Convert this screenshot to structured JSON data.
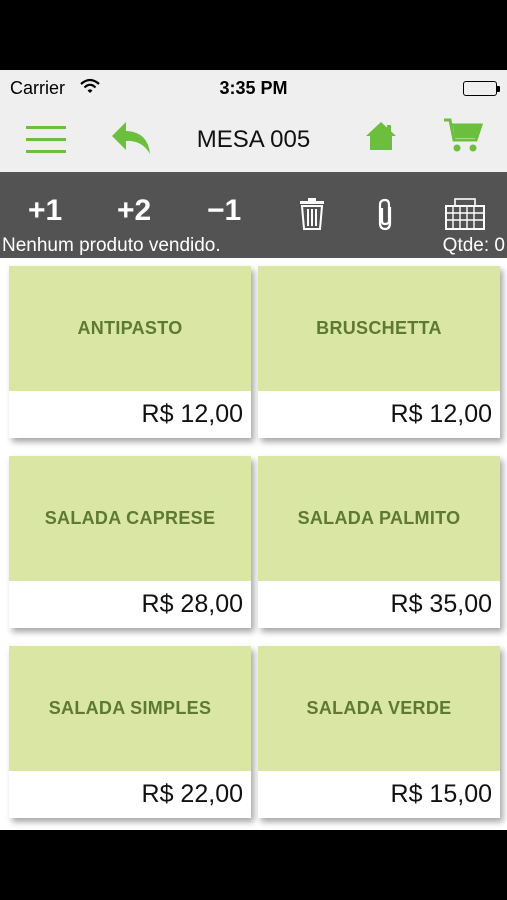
{
  "statusbar": {
    "carrier": "Carrier",
    "time": "3:35 PM"
  },
  "navbar": {
    "title": "MESA 005",
    "icons": [
      "menu-icon",
      "reply-icon",
      "home-icon",
      "cart-icon"
    ],
    "accent_color": "#6cbf3c"
  },
  "toolbar": {
    "plus1": "+1",
    "plus2": "+2",
    "minus1": "−1",
    "icons": [
      "trash-icon",
      "paperclip-icon",
      "keyboard-icon"
    ],
    "status_left": "Nenhum produto vendido.",
    "status_right": "Qtde: 0",
    "background": "#535353"
  },
  "products": [
    {
      "name": "ANTIPASTO",
      "price": "R$ 12,00"
    },
    {
      "name": "BRUSCHETTA",
      "price": "R$ 12,00"
    },
    {
      "name": "SALADA CAPRESE",
      "price": "R$ 28,00"
    },
    {
      "name": "SALADA PALMITO",
      "price": "R$ 35,00"
    },
    {
      "name": "SALADA SIMPLES",
      "price": "R$ 22,00"
    },
    {
      "name": "SALADA VERDE",
      "price": "R$ 15,00"
    }
  ],
  "colors": {
    "card_top": "#d9e6a4",
    "card_text": "#5e7a2e"
  }
}
